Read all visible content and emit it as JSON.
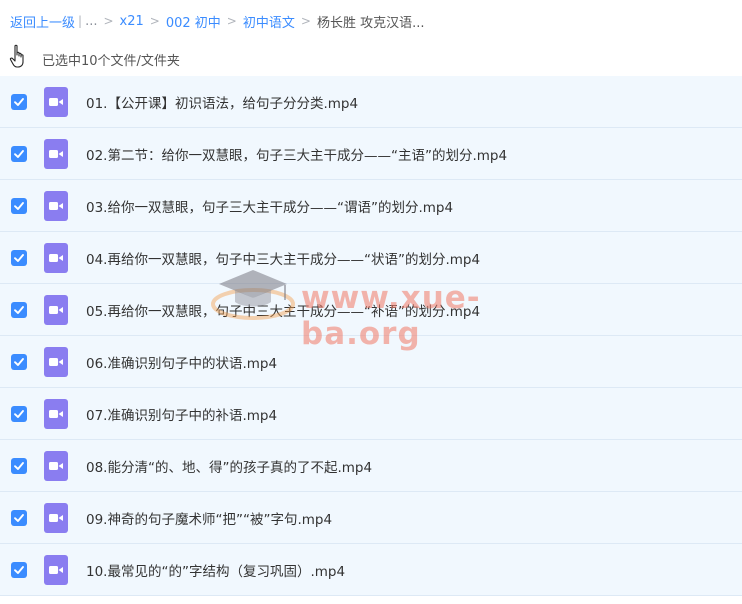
{
  "breadcrumb": {
    "back": "返回上一级",
    "ellipsis": "...",
    "items": [
      "x21",
      "002 初中",
      "初中语文"
    ],
    "current": "杨长胜 攻克汉语..."
  },
  "selection": {
    "text": "已选中10个文件/文件夹"
  },
  "files": [
    "01.【公开课】初识语法，给句子分分类.mp4",
    "02.第二节：给你一双慧眼，句子三大主干成分——“主语”的划分.mp4",
    "03.给你一双慧眼，句子三大主干成分——“谓语”的划分.mp4",
    "04.再给你一双慧眼，句子中三大主干成分——“状语”的划分.mp4",
    "05.再给你一双慧眼，句子中三大主干成分——“补语”的划分.mp4",
    "06.准确识别句子中的状语.mp4",
    "07.准确识别句子中的补语.mp4",
    "08.能分清“的、地、得”的孩子真的了不起.mp4",
    "09.神奇的句子魔术师“把”“被”字句.mp4",
    "10.最常见的“的”字结构（复习巩固）.mp4"
  ],
  "watermark": {
    "text": "www.xue-ba.org"
  },
  "colors": {
    "accent": "#3b8cff",
    "row_bg": "#f1f8fe",
    "video_icon": "#8a7df0"
  },
  "icons": {
    "checkbox": "checkmark-icon",
    "file": "video-file-icon",
    "cursor": "hand-cursor-icon"
  }
}
